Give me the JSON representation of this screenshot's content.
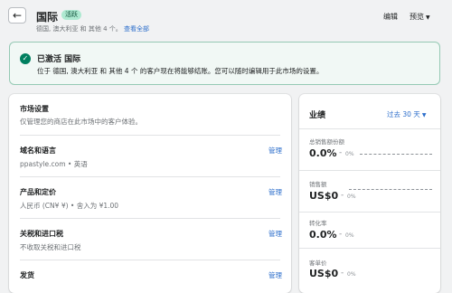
{
  "header": {
    "title": "国际",
    "badge": "活跃",
    "subtitle": "德国, 澳大利亚 和 其他 4 个。",
    "view_all": "查看全部",
    "edit": "编辑",
    "preview": "预览"
  },
  "banner": {
    "title": "已激活 国际",
    "text": "位于 德国, 澳大利亚 和 其他 4 个 的客户现在将能够结账。您可以随时编辑用于此市场的设置。"
  },
  "settings": {
    "title": "市场设置",
    "description": "仅管理您的商店在此市场中的客户体验。",
    "sections": [
      {
        "title": "域名和语言",
        "detail": "ppastyle.com • 英语",
        "action": "管理"
      },
      {
        "title": "产品和定价",
        "detail": "人民币 (CN¥ ¥) • 舍入为 ¥1.00",
        "action": "管理"
      },
      {
        "title": "关税和进口税",
        "detail": "不收取关税和进口税",
        "action": "管理"
      },
      {
        "title": "发货",
        "detail": "",
        "action": "管理"
      }
    ]
  },
  "performance": {
    "title": "业绩",
    "period": "过去 30 天",
    "metrics": [
      {
        "label": "总销售额份额",
        "value": "0.0%",
        "change": "0%"
      },
      {
        "label": "销售额",
        "value": "US$0",
        "change": "0%"
      },
      {
        "label": "转化率",
        "value": "0.0%",
        "change": "0%"
      },
      {
        "label": "客单价",
        "value": "US$0",
        "change": "0%"
      }
    ]
  },
  "colors": {
    "accent": "#2c6ecb",
    "success_banner_bg": "#f1f8f5",
    "success_icon": "#007f5f",
    "badge_bg": "#aee9d1"
  },
  "icons": {
    "back": "arrow-left-icon",
    "banner": "check-circle-icon",
    "dropdown": "chevron-down-icon"
  }
}
